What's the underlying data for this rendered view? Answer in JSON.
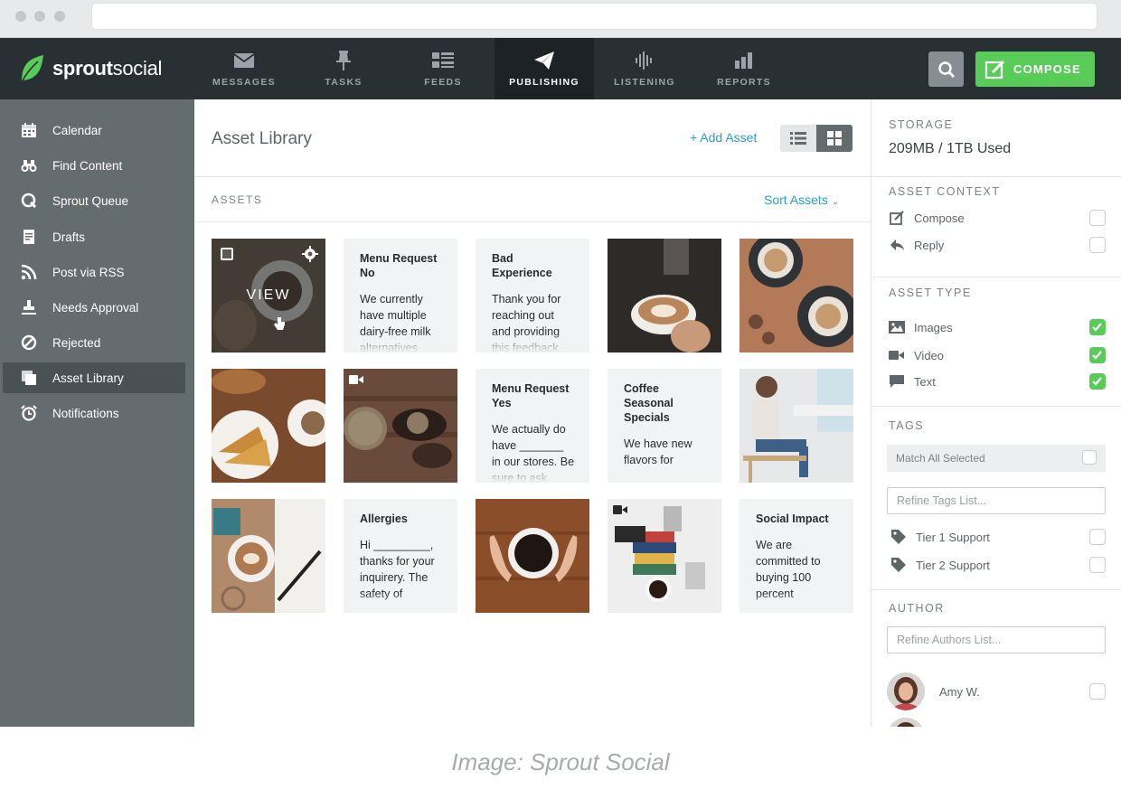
{
  "caption": "Image: Sprout Social",
  "brand": {
    "bold": "sprout",
    "light": "social"
  },
  "nav": [
    {
      "label": "MESSAGES",
      "icon": "envelope-icon"
    },
    {
      "label": "TASKS",
      "icon": "pin-icon"
    },
    {
      "label": "FEEDS",
      "icon": "list-icon"
    },
    {
      "label": "PUBLISHING",
      "icon": "paper-plane-icon",
      "active": true
    },
    {
      "label": "LISTENING",
      "icon": "sound-wave-icon"
    },
    {
      "label": "REPORTS",
      "icon": "bar-chart-icon"
    }
  ],
  "compose_label": "COMPOSE",
  "sidebar": {
    "items": [
      {
        "label": "Calendar",
        "icon": "calendar-icon"
      },
      {
        "label": "Find Content",
        "icon": "binoculars-icon"
      },
      {
        "label": "Sprout Queue",
        "icon": "queue-icon"
      },
      {
        "label": "Drafts",
        "icon": "document-icon"
      },
      {
        "label": "Post via RSS",
        "icon": "rss-icon"
      },
      {
        "label": "Needs Approval",
        "icon": "stamp-icon"
      },
      {
        "label": "Rejected",
        "icon": "block-icon"
      },
      {
        "label": "Asset Library",
        "icon": "library-icon",
        "active": true
      },
      {
        "label": "Notifications",
        "icon": "alarm-clock-icon"
      }
    ]
  },
  "main": {
    "title": "Asset Library",
    "add_asset": "+ Add Asset",
    "assets_label": "ASSETS",
    "sort_label": "Sort Assets",
    "hover_label": "VIEW",
    "text_assets": [
      {
        "title": "Menu Request No",
        "body": "We currently have multiple dairy-free milk alternatives"
      },
      {
        "title": "Bad Experience",
        "body": "Thank you for reaching out and providing this feedback"
      },
      {
        "title": "Menu Request Yes",
        "body": "We actually do have _______ in our stores. Be sure to ask"
      },
      {
        "title": "Coffee Seasonal Specials",
        "body": "We have new flavors for"
      },
      {
        "title": "Allergies",
        "body": "Hi _________, thanks for your inquirery. The safety of"
      },
      {
        "title": "Social Impact",
        "body": "We are committed to buying 100 percent"
      }
    ]
  },
  "right": {
    "storage_label": "STORAGE",
    "storage_value": "209MB / 1TB Used",
    "context_label": "ASSET CONTEXT",
    "context": [
      {
        "label": "Compose",
        "icon": "compose-icon",
        "checked": false
      },
      {
        "label": "Reply",
        "icon": "reply-icon",
        "checked": false
      }
    ],
    "type_label": "ASSET TYPE",
    "types": [
      {
        "label": "Images",
        "icon": "image-icon",
        "checked": true
      },
      {
        "label": "Video",
        "icon": "video-icon",
        "checked": true
      },
      {
        "label": "Text",
        "icon": "speech-bubble-icon",
        "checked": true
      }
    ],
    "tags_label": "TAGS",
    "match_all": "Match All Selected",
    "tags_placeholder": "Refine Tags List...",
    "tags": [
      {
        "label": "Tier 1 Support",
        "checked": false
      },
      {
        "label": "Tier 2 Support",
        "checked": false
      }
    ],
    "author_label": "AUTHOR",
    "authors_placeholder": "Refine Authors List...",
    "authors": [
      {
        "name": "Amy W.",
        "checked": false
      }
    ]
  },
  "colors": {
    "nav_bg": "#283033",
    "sidebar_bg": "#646c6f",
    "accent_green": "#59cb59",
    "link_blue": "#2a9fc5"
  }
}
